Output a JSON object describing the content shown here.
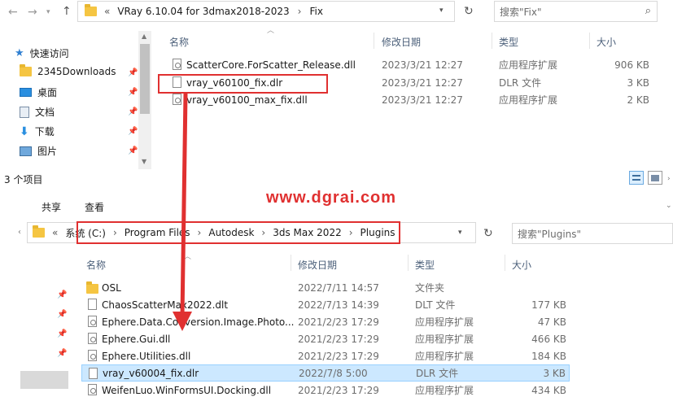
{
  "top": {
    "address_sep": "«",
    "address_path": "VRay 6.10.04 for 3dmax2018-2023",
    "address_arrow": "›",
    "address_last": "Fix",
    "search_placeholder": "搜索\"Fix\"",
    "sidebar": [
      {
        "label": "快速访问",
        "icon": "star-icon"
      },
      {
        "label": "2345Downloads",
        "icon": "folder-icon"
      },
      {
        "label": "桌面",
        "icon": "desktop-icon"
      },
      {
        "label": "文档",
        "icon": "document-icon"
      },
      {
        "label": "下载",
        "icon": "download-icon"
      },
      {
        "label": "图片",
        "icon": "picture-icon"
      }
    ],
    "columns": {
      "name": "名称",
      "date": "修改日期",
      "type": "类型",
      "size": "大小"
    },
    "files": [
      {
        "name": "ScatterCore.ForScatter_Release.dll",
        "date": "2023/3/21 12:27",
        "type": "应用程序扩展",
        "size": "906 KB",
        "icon": "dll"
      },
      {
        "name": "vray_v60100_fix.dlr",
        "date": "2023/3/21 12:27",
        "type": "DLR 文件",
        "size": "3 KB",
        "icon": "file"
      },
      {
        "name": "vray_v60100_max_fix.dll",
        "date": "2023/3/21 12:27",
        "type": "应用程序扩展",
        "size": "2 KB",
        "icon": "dll"
      }
    ],
    "status": "3 个项目"
  },
  "watermark": "www.dgrai.com",
  "ribbon": {
    "share": "共享",
    "view": "查看"
  },
  "bottom": {
    "address_sep": "«",
    "crumbs": [
      "系统 (C:)",
      "Program Files",
      "Autodesk",
      "3ds Max 2022",
      "Plugins"
    ],
    "address_arrow": "›",
    "search_placeholder": "搜索\"Plugins\"",
    "columns": {
      "name": "名称",
      "date": "修改日期",
      "type": "类型",
      "size": "大小"
    },
    "files": [
      {
        "name": "OSL",
        "date": "2022/7/11 14:57",
        "type": "文件夹",
        "size": "",
        "icon": "folder"
      },
      {
        "name": "ChaosScatterMax2022.dlt",
        "date": "2022/7/13 14:39",
        "type": "DLT 文件",
        "size": "177 KB",
        "icon": "file"
      },
      {
        "name": "Ephere.Data.Conversion.Image.Photo...",
        "date": "2021/2/23 17:29",
        "type": "应用程序扩展",
        "size": "47 KB",
        "icon": "dll"
      },
      {
        "name": "Ephere.Gui.dll",
        "date": "2021/2/23 17:29",
        "type": "应用程序扩展",
        "size": "466 KB",
        "icon": "dll"
      },
      {
        "name": "Ephere.Utilities.dll",
        "date": "2021/2/23 17:29",
        "type": "应用程序扩展",
        "size": "184 KB",
        "icon": "dll"
      },
      {
        "name": "vray_v60004_fix.dlr",
        "date": "2022/7/8 5:00",
        "type": "DLR 文件",
        "size": "3 KB",
        "icon": "file"
      },
      {
        "name": "WeifenLuo.WinFormsUI.Docking.dll",
        "date": "2021/2/23 17:29",
        "type": "应用程序扩展",
        "size": "434 KB",
        "icon": "dll"
      }
    ]
  },
  "colors": {
    "highlight": "#e03030",
    "selection": "#cce8ff",
    "header_text": "#4c607a"
  }
}
